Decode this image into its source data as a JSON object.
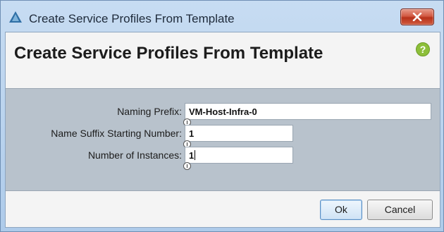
{
  "window": {
    "title": "Create Service Profiles From Template",
    "close_label": "X"
  },
  "dialog": {
    "heading": "Create Service Profiles From Template",
    "help_label": "?"
  },
  "form": {
    "naming_prefix": {
      "label": "Naming Prefix:",
      "value": "VM-Host-Infra-0"
    },
    "suffix_start": {
      "label": "Name Suffix Starting Number:",
      "value": "1"
    },
    "instances": {
      "label": "Number of Instances:",
      "value": "1"
    }
  },
  "buttons": {
    "ok": "Ok",
    "cancel": "Cancel"
  },
  "colors": {
    "form_background": "#b8c2cc",
    "help_icon": "#8dbf3a",
    "close_button": "#c9452b"
  }
}
